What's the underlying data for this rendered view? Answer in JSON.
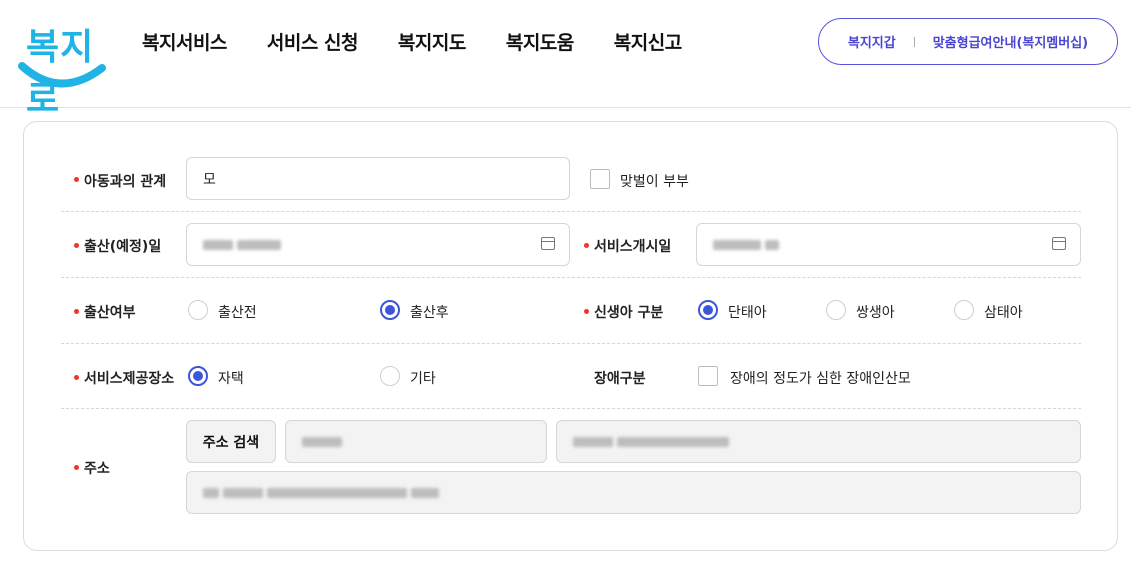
{
  "header": {
    "nav": [
      "복지서비스",
      "서비스 신청",
      "복지지도",
      "복지도움",
      "복지신고"
    ],
    "pill_links": [
      "복지지갑",
      "맞춤형급여안내(복지멤버십)"
    ]
  },
  "form": {
    "relation": {
      "label": "아동과의 관계",
      "value": "모"
    },
    "dual_income": {
      "label": "맞벌이 부부",
      "checked": false
    },
    "birth_date": {
      "label": "출산(예정)일"
    },
    "service_start": {
      "label": "서비스개시일"
    },
    "birth_status": {
      "label": "출산여부",
      "options": [
        "출산전",
        "출산후"
      ],
      "selected": "출산후"
    },
    "newborn_type": {
      "label": "신생아 구분",
      "options": [
        "단태아",
        "쌍생아",
        "삼태아"
      ],
      "selected": "단태아"
    },
    "service_place": {
      "label": "서비스제공장소",
      "options": [
        "자택",
        "기타"
      ],
      "selected": "자택"
    },
    "disability": {
      "label": "장애구분",
      "option": "장애의 정도가 심한 장애인산모",
      "checked": false
    },
    "address": {
      "label": "주소",
      "search_button": "주소 검색"
    }
  },
  "colors": {
    "accent": "#3b56d8",
    "pill": "#4a44d0",
    "required": "#ee3333",
    "logo": "#1fb3e6"
  }
}
